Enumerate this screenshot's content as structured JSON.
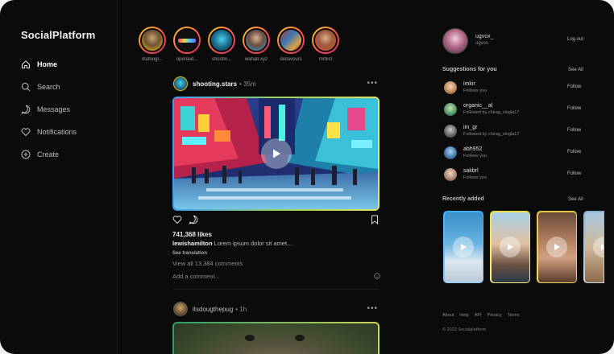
{
  "app": {
    "brand": "SocialPlatform"
  },
  "nav": [
    {
      "label": "Home",
      "icon": "home-icon",
      "active": true
    },
    {
      "label": "Search",
      "icon": "search-icon"
    },
    {
      "label": "Messages",
      "icon": "message-icon"
    },
    {
      "label": "Notifications",
      "icon": "heart-icon"
    },
    {
      "label": "Create",
      "icon": "plus-circle-icon"
    }
  ],
  "stories": [
    {
      "label": "itsdougl..."
    },
    {
      "label": "openaid..."
    },
    {
      "label": "shootin..."
    },
    {
      "label": "wahab.xyz"
    },
    {
      "label": "dellavours"
    },
    {
      "label": "mrbist"
    }
  ],
  "post1": {
    "user": "shooting.stars",
    "time": "• 35m",
    "likes": "741,368 likes",
    "caption_user": "lewishamilton",
    "caption_text": " Lorem ipsum dolor sit amet...",
    "see_translation": "See translation",
    "view_comments": "View all 13,384 comments",
    "add_comment": "Add a comment..."
  },
  "post2": {
    "user": "itsdougthepug",
    "time": "• 1h"
  },
  "me": {
    "name": "ugvox_",
    "sub": "ugvox",
    "logout": "Log out"
  },
  "suggestions": {
    "title": "Suggestions for you",
    "see_all": "See All",
    "follow_label": "Follow",
    "items": [
      {
        "name": "imkir",
        "sub": "Follows you"
      },
      {
        "name": "organic__al",
        "sub": "Followed by chirag_singla17"
      },
      {
        "name": "im_gr",
        "sub": "Followed by chirag_singla17"
      },
      {
        "name": "abh952",
        "sub": "Follows you"
      },
      {
        "name": "sakbrl",
        "sub": "Follows you"
      }
    ]
  },
  "recent": {
    "title": "Recently added",
    "see_all": "See All"
  },
  "footer": {
    "links": [
      "About",
      "Help",
      "API",
      "Privacy",
      "Terms"
    ],
    "copyright": "© 2023 Socialplatform"
  },
  "colors": {
    "background": "#0b0b0c",
    "accent": "#f2b600"
  }
}
